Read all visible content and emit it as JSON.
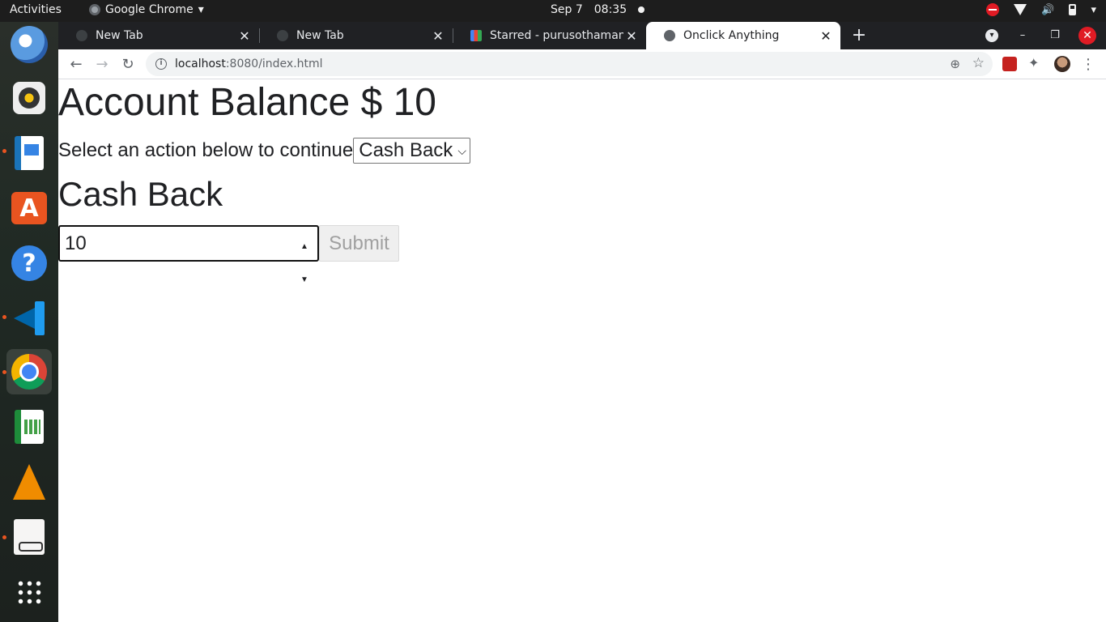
{
  "system": {
    "activities_label": "Activities",
    "app_menu_label": "Google Chrome",
    "date": "Sep 7",
    "time": "08:35"
  },
  "browser": {
    "tabs": [
      {
        "title": "New Tab"
      },
      {
        "title": "New Tab"
      },
      {
        "title": "Starred - purusothaman@"
      },
      {
        "title": "Onclick Anything"
      }
    ],
    "url_host": "localhost",
    "url_rest": ":8080/index.html"
  },
  "page": {
    "balance_heading": "Account Balance $ 10",
    "select_prompt": "Select an action below to continue",
    "selected_action": "Cash Back",
    "section_heading": "Cash Back",
    "amount_value": "10",
    "submit_label": "Submit"
  },
  "colors": {
    "accent_running": "#e95420",
    "close_button": "#e01b24"
  }
}
